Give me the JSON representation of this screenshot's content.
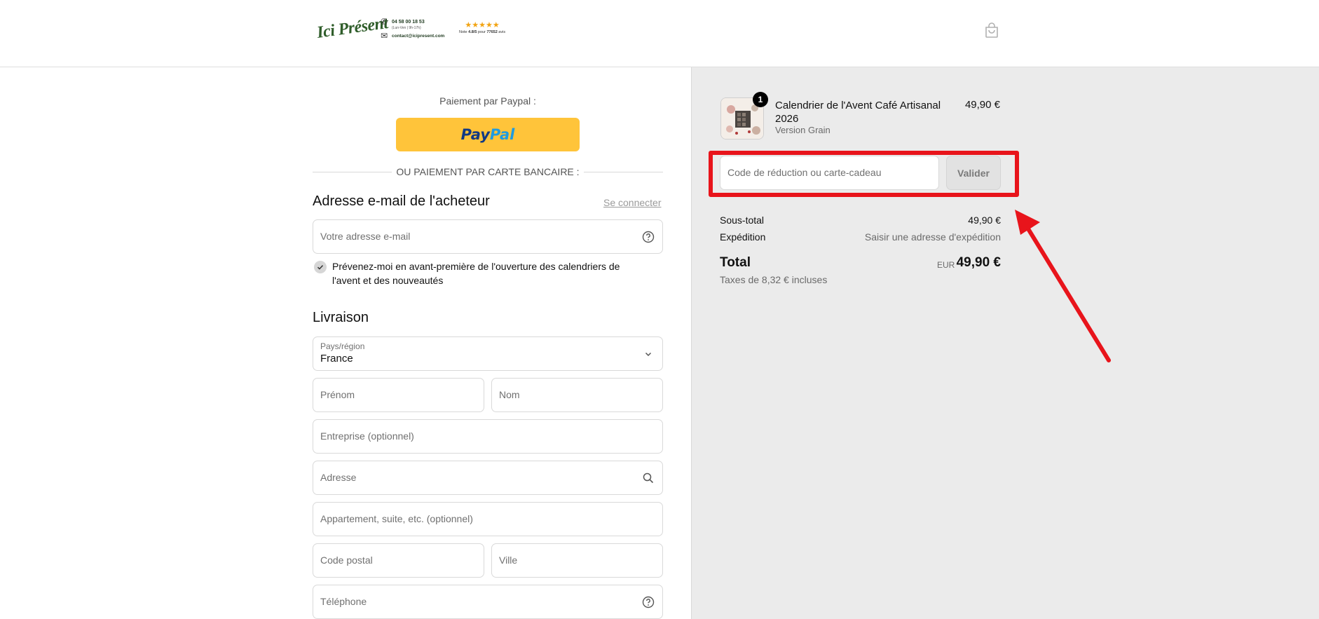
{
  "header": {
    "logo_text": "Ici Présent",
    "phone": "04 58 00 18 53",
    "hours": "(Lun-Ven | 9h-17h)",
    "email": "contact@icipresent.com",
    "stars": "★★★★★",
    "rating_note_prefix": "Note",
    "rating_value": "4.8/5",
    "rating_mid": "pour",
    "rating_count": "77652",
    "rating_suffix": "avis"
  },
  "checkout": {
    "paypal_label": "Paiement par Paypal :",
    "paypal_pay": "Pay",
    "paypal_pal": "Pal",
    "divider_text": "OU PAIEMENT PAR CARTE BANCAIRE :",
    "email_section_title": "Adresse e-mail de l'acheteur",
    "login_link": "Se connecter",
    "email_placeholder": "Votre adresse e-mail",
    "newsletter_text": "Prévenez-moi en avant-première de l'ouverture des calendriers de l'avent et des nouveautés",
    "delivery_title": "Livraison",
    "country_label": "Pays/région",
    "country_value": "France",
    "first_name_placeholder": "Prénom",
    "last_name_placeholder": "Nom",
    "company_placeholder": "Entreprise (optionnel)",
    "address_placeholder": "Adresse",
    "apartment_placeholder": "Appartement, suite, etc. (optionnel)",
    "postal_placeholder": "Code postal",
    "city_placeholder": "Ville",
    "phone_placeholder": "Téléphone"
  },
  "summary": {
    "product": {
      "quantity": "1",
      "name": "Calendrier de l'Avent Café Artisanal 2026",
      "variant": "Version Grain",
      "price": "49,90 €"
    },
    "discount_placeholder": "Code de réduction ou carte-cadeau",
    "apply_label": "Valider",
    "subtotal_label": "Sous-total",
    "subtotal_value": "49,90 €",
    "shipping_label": "Expédition",
    "shipping_value": "Saisir une adresse d'expédition",
    "total_label": "Total",
    "total_currency": "EUR",
    "total_value": "49,90 €",
    "taxes_text": "Taxes de 8,32 € incluses"
  },
  "colors": {
    "paypal_yellow": "#ffc43a",
    "highlight_red": "#e8141b",
    "summary_bg": "#ebebeb"
  }
}
